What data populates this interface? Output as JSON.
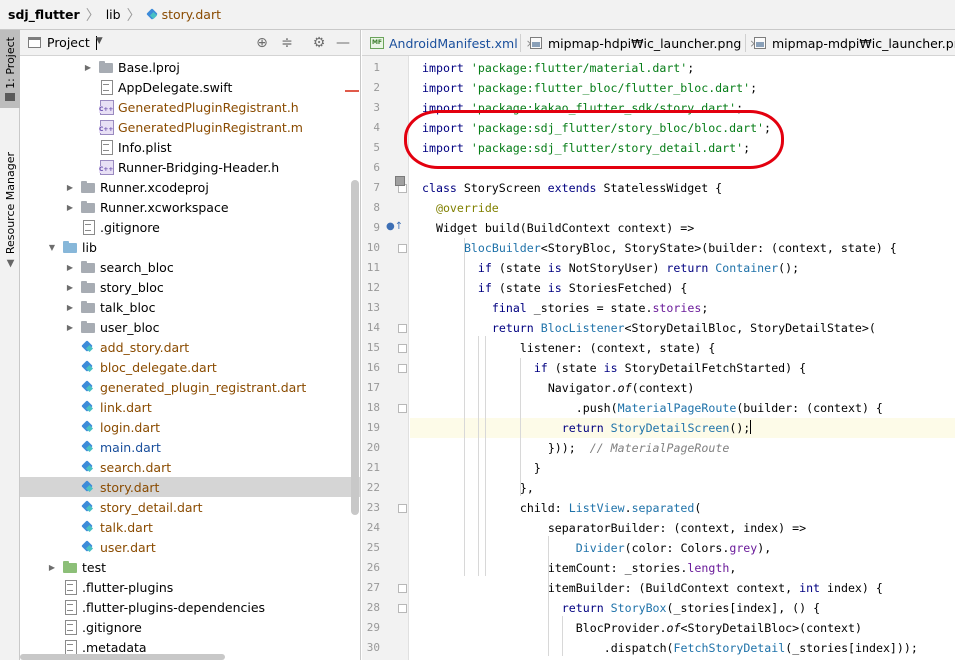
{
  "breadcrumb": {
    "project": "sdj_flutter",
    "folder": "lib",
    "file": "story.dart"
  },
  "toolstrip": {
    "project_tab": "1: Project",
    "resource_tab": "Resource Manager"
  },
  "project_panel": {
    "title": "Project",
    "icons": [
      "target-icon",
      "collapse-icon",
      "gear-icon",
      "minimize-icon"
    ],
    "tree": [
      {
        "label": "Base.lproj",
        "type": "folder",
        "indent": 3,
        "collapsed": true
      },
      {
        "label": "AppDelegate.swift",
        "type": "file",
        "indent": 3
      },
      {
        "label": "GeneratedPluginRegistrant.h",
        "type": "cpp",
        "indent": 3,
        "color": "brown"
      },
      {
        "label": "GeneratedPluginRegistrant.m",
        "type": "cpp",
        "indent": 3,
        "color": "brown"
      },
      {
        "label": "Info.plist",
        "type": "file",
        "indent": 3
      },
      {
        "label": "Runner-Bridging-Header.h",
        "type": "cpp",
        "indent": 3
      },
      {
        "label": "Runner.xcodeproj",
        "type": "folder",
        "indent": 2,
        "collapsed": true
      },
      {
        "label": "Runner.xcworkspace",
        "type": "folder",
        "indent": 2,
        "collapsed": true
      },
      {
        "label": ".gitignore",
        "type": "file",
        "indent": 2
      },
      {
        "label": "lib",
        "type": "folder-blue",
        "indent": 1,
        "expanded": true
      },
      {
        "label": "search_bloc",
        "type": "folder",
        "indent": 2,
        "collapsed": true
      },
      {
        "label": "story_bloc",
        "type": "folder",
        "indent": 2,
        "collapsed": true
      },
      {
        "label": "talk_bloc",
        "type": "folder",
        "indent": 2,
        "collapsed": true
      },
      {
        "label": "user_bloc",
        "type": "folder",
        "indent": 2,
        "collapsed": true
      },
      {
        "label": "add_story.dart",
        "type": "dart",
        "indent": 2,
        "color": "brown"
      },
      {
        "label": "bloc_delegate.dart",
        "type": "dart",
        "indent": 2,
        "color": "brown"
      },
      {
        "label": "generated_plugin_registrant.dart",
        "type": "dart",
        "indent": 2,
        "color": "brown"
      },
      {
        "label": "link.dart",
        "type": "dart",
        "indent": 2,
        "color": "brown"
      },
      {
        "label": "login.dart",
        "type": "dart",
        "indent": 2,
        "color": "brown"
      },
      {
        "label": "main.dart",
        "type": "dart",
        "indent": 2,
        "color": "blue"
      },
      {
        "label": "search.dart",
        "type": "dart",
        "indent": 2,
        "color": "brown"
      },
      {
        "label": "story.dart",
        "type": "dart",
        "indent": 2,
        "color": "brown",
        "selected": true
      },
      {
        "label": "story_detail.dart",
        "type": "dart",
        "indent": 2,
        "color": "brown"
      },
      {
        "label": "talk.dart",
        "type": "dart",
        "indent": 2,
        "color": "brown"
      },
      {
        "label": "user.dart",
        "type": "dart",
        "indent": 2,
        "color": "brown"
      },
      {
        "label": "test",
        "type": "folder-green",
        "indent": 1,
        "collapsed": true
      },
      {
        "label": ".flutter-plugins",
        "type": "file",
        "indent": 1
      },
      {
        "label": ".flutter-plugins-dependencies",
        "type": "file",
        "indent": 1
      },
      {
        "label": ".gitignore",
        "type": "file",
        "indent": 1
      },
      {
        "label": ".metadata",
        "type": "file",
        "indent": 1
      }
    ]
  },
  "editor": {
    "tabs": [
      {
        "label": "AndroidManifest.xml",
        "icon": "manifest-icon",
        "close": "×"
      },
      {
        "label": "mipmap-hdpi₩ic_launcher.png",
        "icon": "image-icon",
        "close": "×"
      },
      {
        "label": "mipmap-mdpi₩ic_launcher.png",
        "icon": "image-icon",
        "close": "×"
      }
    ],
    "mf_badge": "MF",
    "lines": [
      {
        "n": "1",
        "indent": 0,
        "tokens": [
          [
            "kw",
            "import "
          ],
          [
            "str",
            "'package:flutter/material.dart'"
          ],
          [
            "",
            "; "
          ]
        ]
      },
      {
        "n": "2",
        "indent": 0,
        "tokens": [
          [
            "kw",
            "import "
          ],
          [
            "str",
            "'package:flutter_bloc/flutter_bloc.dart'"
          ],
          [
            "",
            ";"
          ]
        ]
      },
      {
        "n": "3",
        "indent": 0,
        "tokens": [
          [
            "kw",
            "import "
          ],
          [
            "str",
            "'package:kakao_flutter_sdk/story.dart'"
          ],
          [
            "",
            ";"
          ]
        ]
      },
      {
        "n": "4",
        "indent": 0,
        "tokens": [
          [
            "kw",
            "import "
          ],
          [
            "str",
            "'package:sdj_flutter/story_bloc/bloc.dart'"
          ],
          [
            "",
            ";"
          ]
        ]
      },
      {
        "n": "5",
        "indent": 0,
        "tokens": [
          [
            "kw",
            "import "
          ],
          [
            "str",
            "'package:sdj_flutter/story_detail.dart'"
          ],
          [
            "",
            ";"
          ]
        ]
      },
      {
        "n": "6",
        "indent": 0,
        "tokens": []
      },
      {
        "n": "7",
        "indent": 0,
        "tokens": [
          [
            "kw",
            "class "
          ],
          [
            "",
            "StoryScreen "
          ],
          [
            "kw",
            "extends "
          ],
          [
            "",
            "StatelessWidget {"
          ]
        ]
      },
      {
        "n": "8",
        "indent": 1,
        "tokens": [
          [
            "ann",
            "@override"
          ]
        ]
      },
      {
        "n": "9",
        "indent": 1,
        "tokens": [
          [
            "",
            "Widget build(BuildContext context) =>"
          ]
        ]
      },
      {
        "n": "10",
        "indent": 3,
        "tokens": [
          [
            "ty",
            "BlocBuilder"
          ],
          [
            "",
            "<StoryBloc, StoryState>(builder: (context, state) {"
          ]
        ]
      },
      {
        "n": "11",
        "indent": 4,
        "tokens": [
          [
            "kw",
            "if "
          ],
          [
            "",
            "(state "
          ],
          [
            "kw",
            "is "
          ],
          [
            "",
            "NotStoryUser) "
          ],
          [
            "kw",
            "return "
          ],
          [
            "ty",
            "Container"
          ],
          [
            "",
            "();"
          ]
        ]
      },
      {
        "n": "12",
        "indent": 4,
        "tokens": [
          [
            "kw",
            "if "
          ],
          [
            "",
            "(state "
          ],
          [
            "kw",
            "is "
          ],
          [
            "",
            "StoriesFetched) {"
          ]
        ]
      },
      {
        "n": "13",
        "indent": 5,
        "tokens": [
          [
            "kw",
            "final "
          ],
          [
            "",
            "_stories = state."
          ],
          [
            "prop",
            "stories"
          ],
          [
            "",
            ";"
          ]
        ]
      },
      {
        "n": "14",
        "indent": 5,
        "tokens": [
          [
            "kw",
            "return "
          ],
          [
            "ty",
            "BlocListener"
          ],
          [
            "",
            "<StoryDetailBloc, StoryDetailState>("
          ]
        ]
      },
      {
        "n": "15",
        "indent": 7,
        "tokens": [
          [
            "",
            "listener: (context, state) {"
          ]
        ]
      },
      {
        "n": "16",
        "indent": 8,
        "tokens": [
          [
            "kw",
            "if "
          ],
          [
            "",
            "(state "
          ],
          [
            "kw",
            "is "
          ],
          [
            "",
            "StoryDetailFetchStarted) {"
          ]
        ]
      },
      {
        "n": "17",
        "indent": 9,
        "tokens": [
          [
            "",
            "Navigator."
          ],
          [
            "ital",
            "of"
          ],
          [
            "",
            "(context)"
          ]
        ]
      },
      {
        "n": "18",
        "indent": 11,
        "tokens": [
          [
            "",
            ".push("
          ],
          [
            "ty",
            "MaterialPageRoute"
          ],
          [
            "",
            "(builder: (context) {"
          ]
        ]
      },
      {
        "n": "19",
        "indent": 10,
        "tokens": [
          [
            "kw",
            "return "
          ],
          [
            "ty",
            "StoryDetailScreen"
          ],
          [
            "",
            "();"
          ]
        ],
        "current": true
      },
      {
        "n": "20",
        "indent": 9,
        "tokens": [
          [
            "",
            "}));  "
          ],
          [
            "cmt",
            "// MaterialPageRoute"
          ]
        ]
      },
      {
        "n": "21",
        "indent": 8,
        "tokens": [
          [
            "",
            "}"
          ]
        ]
      },
      {
        "n": "22",
        "indent": 7,
        "tokens": [
          [
            "",
            "},"
          ]
        ]
      },
      {
        "n": "23",
        "indent": 7,
        "tokens": [
          [
            "",
            "child: "
          ],
          [
            "ty",
            "ListView"
          ],
          [
            "",
            "."
          ],
          [
            "fn",
            "separated"
          ],
          [
            "",
            "("
          ]
        ]
      },
      {
        "n": "24",
        "indent": 9,
        "tokens": [
          [
            "",
            "separatorBuilder: (context, index) =>"
          ]
        ]
      },
      {
        "n": "25",
        "indent": 11,
        "tokens": [
          [
            "ty",
            "Divider"
          ],
          [
            "",
            "(color: Colors."
          ],
          [
            "prop",
            "grey"
          ],
          [
            "",
            "),"
          ]
        ]
      },
      {
        "n": "26",
        "indent": 9,
        "tokens": [
          [
            "",
            "itemCount: _stories."
          ],
          [
            "prop",
            "length"
          ],
          [
            "",
            ","
          ]
        ]
      },
      {
        "n": "27",
        "indent": 9,
        "tokens": [
          [
            "",
            "itemBuilder: (BuildContext context, "
          ],
          [
            "kw",
            "int "
          ],
          [
            "",
            "index) {"
          ]
        ]
      },
      {
        "n": "28",
        "indent": 10,
        "tokens": [
          [
            "kw",
            "return "
          ],
          [
            "ty",
            "StoryBox"
          ],
          [
            "",
            "(_stories[index], () {"
          ]
        ]
      },
      {
        "n": "29",
        "indent": 11,
        "tokens": [
          [
            "",
            "BlocProvider."
          ],
          [
            "ital",
            "of"
          ],
          [
            "",
            "<StoryDetailBloc>(context)"
          ]
        ]
      },
      {
        "n": "30",
        "indent": 13,
        "tokens": [
          [
            "",
            ".dispatch("
          ],
          [
            "ty",
            "FetchStoryDetail"
          ],
          [
            "",
            "(_stories[index]));"
          ]
        ]
      }
    ]
  },
  "colors": {
    "keyword": "#000080",
    "string": "#067d17",
    "type": "#1f72a9",
    "property": "#6a1b9a",
    "annotation": "#808000",
    "comment": "#808080",
    "highlight": "#e3000f"
  }
}
